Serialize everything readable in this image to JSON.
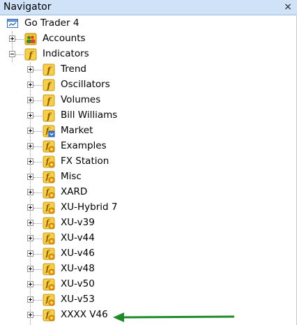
{
  "window": {
    "title": "Navigator",
    "close_glyph": "×"
  },
  "root": {
    "label": "Go Trader 4",
    "icon": "terminal-icon"
  },
  "accounts": {
    "label": "Accounts",
    "icon": "accounts-icon"
  },
  "indicators": {
    "label": "Indicators",
    "icon": "function-icon"
  },
  "children": [
    {
      "label": "Trend",
      "icon": "function-icon"
    },
    {
      "label": "Oscillators",
      "icon": "function-icon"
    },
    {
      "label": "Volumes",
      "icon": "function-icon"
    },
    {
      "label": "Bill Williams",
      "icon": "function-icon"
    },
    {
      "label": "Market",
      "icon": "market-function-icon"
    },
    {
      "label": "Examples",
      "icon": "custom-function-icon"
    },
    {
      "label": "FX Station",
      "icon": "custom-function-icon"
    },
    {
      "label": "Misc",
      "icon": "custom-function-icon"
    },
    {
      "label": "XARD",
      "icon": "custom-function-icon"
    },
    {
      "label": "XU-Hybrid 7",
      "icon": "custom-function-icon"
    },
    {
      "label": "XU-v39",
      "icon": "custom-function-icon"
    },
    {
      "label": "XU-v44",
      "icon": "custom-function-icon"
    },
    {
      "label": "XU-v46",
      "icon": "custom-function-icon"
    },
    {
      "label": "XU-v48",
      "icon": "custom-function-icon"
    },
    {
      "label": "XU-v50",
      "icon": "custom-function-icon"
    },
    {
      "label": "XU-v53",
      "icon": "custom-function-icon"
    },
    {
      "label": "XXXX V46",
      "icon": "custom-function-icon"
    }
  ],
  "colors": {
    "titlebar": "#cfe2f8",
    "arrow": "#1f8a2a",
    "folder_yellow": "#f5c634"
  }
}
